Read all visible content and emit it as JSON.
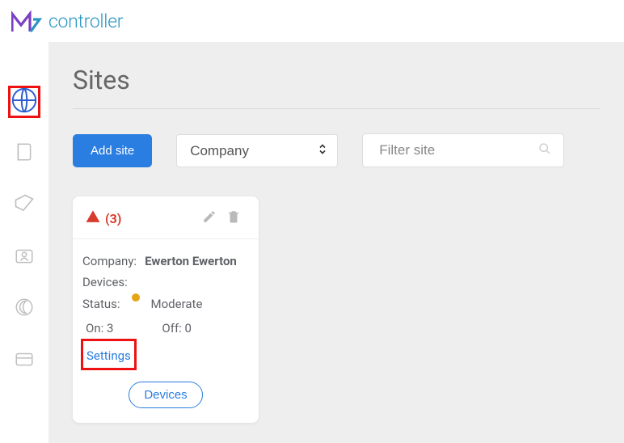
{
  "brand": {
    "text": "controller"
  },
  "page": {
    "title": "Sites"
  },
  "toolbar": {
    "add_label": "Add site",
    "select_value": "Company",
    "filter_placeholder": "Filter site"
  },
  "card": {
    "alert_count": "(3)",
    "labels": {
      "company": "Company:",
      "devices": "Devices:",
      "status": "Status:",
      "on": "On:",
      "off": "Off:",
      "settings": "Settings"
    },
    "company": "Ewerton Ewerton",
    "devices": "",
    "status": "Moderate",
    "on": "3",
    "off": "0",
    "devices_button": "Devices"
  }
}
